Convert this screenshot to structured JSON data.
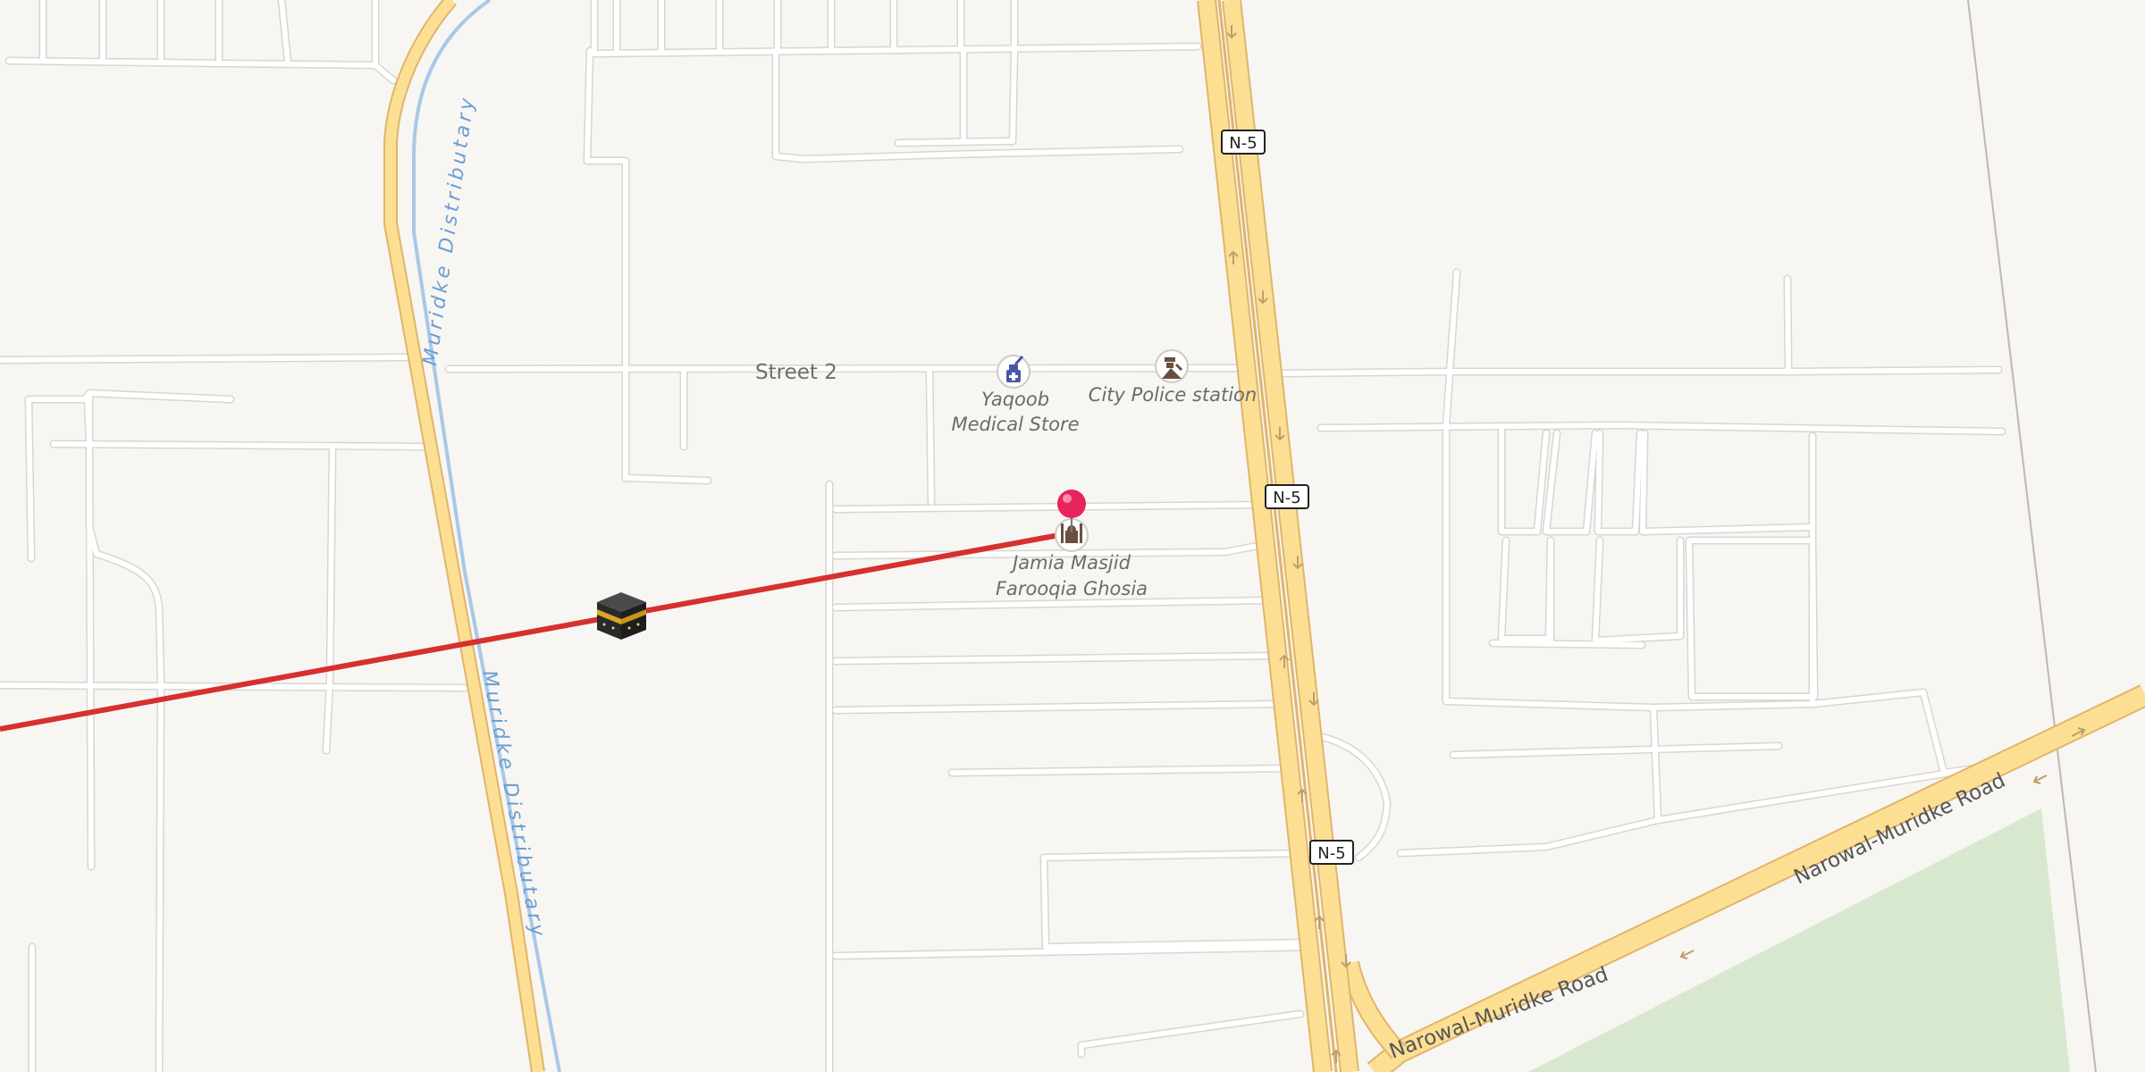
{
  "map": {
    "streets": {
      "street_2": "Street 2"
    },
    "highway": {
      "shield_label": "N-5",
      "fill_color": "#fddf94",
      "casing_color": "#e0b56a"
    },
    "waterway": {
      "name": "Muridke Distributary",
      "color": "#a8c8e8"
    },
    "road_name": "Narowal-Muridke Road",
    "pois": {
      "medical_store_line1": "Yaqoob",
      "medical_store_line2": "Medical Store",
      "police_station": "City Police station",
      "mosque_line1": "Jamia Masjid",
      "mosque_line2": "Farooqia Ghosia"
    },
    "icons": {
      "medical": "pharmacy-icon",
      "police": "police-icon",
      "mosque": "mosque-icon",
      "kaaba": "kaaba-icon",
      "pin": "location-pin-icon"
    },
    "colors": {
      "background": "#f8f6f2",
      "park": "#d8e8cf",
      "qibla_line": "#d63030",
      "pin": "#e8245a"
    }
  }
}
